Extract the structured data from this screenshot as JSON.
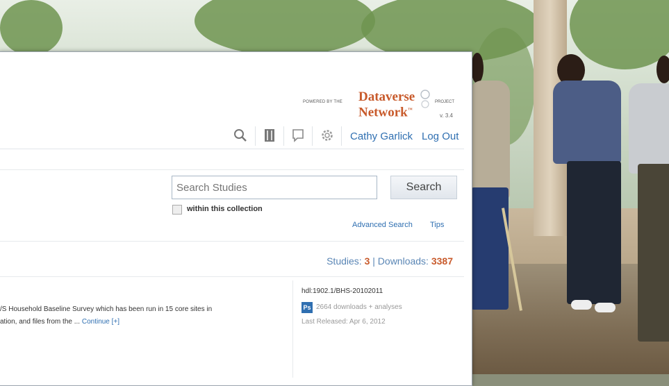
{
  "brand": {
    "powered_by": "POWERED BY THE",
    "name_line1": "Dataverse",
    "name_line2": "Network",
    "project": "PROJECT",
    "version": "v. 3.4"
  },
  "toolbar": {
    "icons": [
      "search-icon",
      "bookmark-icon",
      "comment-icon",
      "gear-icon"
    ],
    "user_name": "Cathy Garlick",
    "logout": "Log Out"
  },
  "search": {
    "placeholder": "Search Studies",
    "button": "Search",
    "within_label": "within this collection",
    "advanced": "Advanced Search",
    "tips": "Tips"
  },
  "stats": {
    "studies_label": "Studies:",
    "studies_value": "3",
    "separator": "|",
    "downloads_label": "Downloads:",
    "downloads_value": "3387"
  },
  "result": {
    "desc_line1": "/S Household Baseline Survey which has been run in 15 core sites in",
    "desc_line2": "ation, and files from the ...",
    "continue": "Continue [+]",
    "handle": "hdl:1902.1/BHS-20102011",
    "downloads": "2664 downloads + analyses",
    "release": "Last Released: Apr 6, 2012"
  }
}
